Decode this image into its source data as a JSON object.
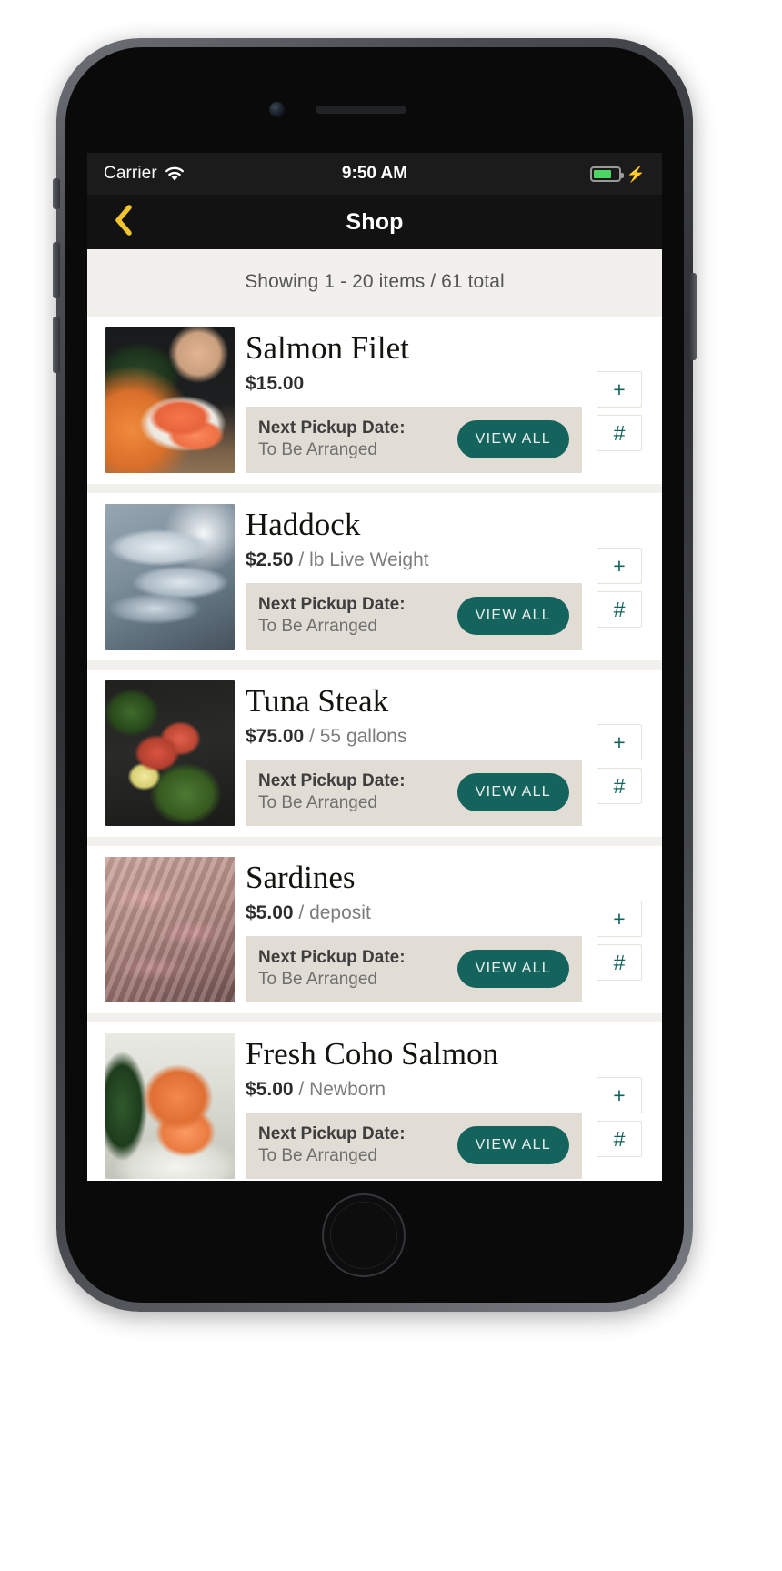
{
  "device": {
    "name": "iphone-mockup"
  },
  "status_bar": {
    "carrier": "Carrier",
    "wifi_icon": "wifi-icon",
    "time": "9:50 AM",
    "battery_icon": "battery-icon",
    "battery_level_percent": 72,
    "charging_icon": "lightning-bolt-icon"
  },
  "nav_bar": {
    "back_icon": "chevron-left-icon",
    "title": "Shop"
  },
  "results_banner": {
    "text": "Showing 1 - 20 items / 61 total",
    "range_start": 1,
    "range_end": 20,
    "total": 61
  },
  "labels": {
    "pickup_label": "Next Pickup Date:",
    "view_all": "VIEW ALL",
    "add_icon": "+",
    "hash_icon": "#"
  },
  "colors": {
    "accent_teal": "#15635d",
    "pickup_bar_bg": "#e2ddd4",
    "page_bg": "#f2f0ec",
    "card_bg": "#ffffff",
    "nav_bg": "#121212",
    "status_bg": "#1b1b1b",
    "back_chevron": "#f2c42e",
    "battery_green": "#4cd763"
  },
  "products": [
    {
      "name": "Salmon Filet",
      "price": "$15.00",
      "unit": "",
      "pickup_label": "Next Pickup Date:",
      "pickup_value": "To Be Arranged",
      "view_all": "VIEW ALL",
      "image": "salmon-filet-photo"
    },
    {
      "name": "Haddock",
      "price": "$2.50",
      "unit": "/ lb Live Weight",
      "pickup_label": "Next Pickup Date:",
      "pickup_value": "To Be Arranged",
      "view_all": "VIEW ALL",
      "image": "haddock-photo"
    },
    {
      "name": "Tuna Steak",
      "price": "$75.00",
      "unit": "/ 55 gallons",
      "pickup_label": "Next Pickup Date:",
      "pickup_value": "To Be Arranged",
      "view_all": "VIEW ALL",
      "image": "tuna-steak-photo"
    },
    {
      "name": "Sardines",
      "price": "$5.00",
      "unit": "/ deposit",
      "pickup_label": "Next Pickup Date:",
      "pickup_value": "To Be Arranged",
      "view_all": "VIEW ALL",
      "image": "sardines-photo"
    },
    {
      "name": "Fresh Coho Salmon",
      "price": "$5.00",
      "unit": "/ Newborn",
      "pickup_label": "Next Pickup Date:",
      "pickup_value": "To Be Arranged",
      "view_all": "VIEW ALL",
      "image": "coho-salmon-photo"
    }
  ]
}
